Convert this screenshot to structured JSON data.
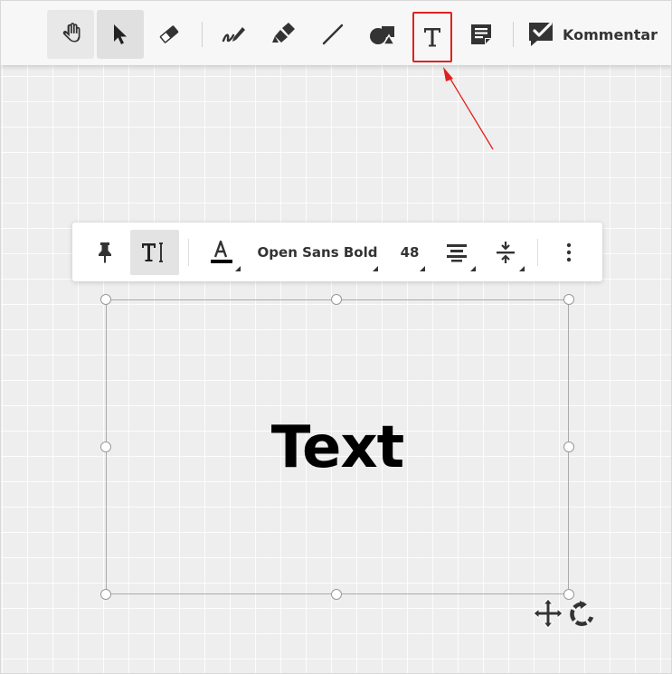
{
  "toolbar": {
    "tools": [
      {
        "name": "hand",
        "icon": "hand-icon"
      },
      {
        "name": "select",
        "icon": "cursor-arrow-icon",
        "active": true
      },
      {
        "name": "eraser",
        "icon": "eraser-icon"
      },
      {
        "name": "pen",
        "icon": "pen-icon"
      },
      {
        "name": "highlighter",
        "icon": "highlighter-icon"
      },
      {
        "name": "line",
        "icon": "line-icon"
      },
      {
        "name": "shapes",
        "icon": "shapes-icon"
      },
      {
        "name": "text",
        "icon": "text-t-icon",
        "highlighted": true
      },
      {
        "name": "sticky-note",
        "icon": "sticky-note-icon"
      }
    ],
    "comment_label": "Kommentar"
  },
  "text_toolbar": {
    "font_name": "Open Sans Bold",
    "font_size": "48",
    "icons": [
      "pin-icon",
      "text-cursor-icon",
      "font-color-icon",
      "align-center-icon",
      "line-spacing-icon",
      "more-vertical-icon"
    ]
  },
  "canvas": {
    "text_content": "Text"
  },
  "colors": {
    "annotation_red": "#e02020",
    "canvas_bg": "#eeeeee",
    "icon_dark": "#333333"
  }
}
